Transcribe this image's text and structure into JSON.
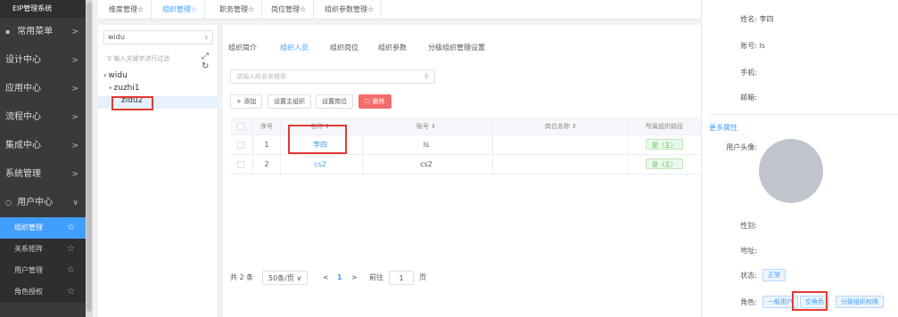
{
  "sidebar": {
    "brand": "EIP管理系统",
    "menus": [
      {
        "label": "常用菜单",
        "chevron": ">"
      },
      {
        "label": "设计中心",
        "chevron": ">"
      },
      {
        "label": "应用中心",
        "chevron": ">"
      },
      {
        "label": "流程中心",
        "chevron": ">"
      },
      {
        "label": "集成中心",
        "chevron": ">"
      },
      {
        "label": "系统管理",
        "chevron": ">"
      },
      {
        "label": "用户中心",
        "chevron": "∨"
      }
    ],
    "sub_items": [
      {
        "label": "组织管理",
        "active": true
      },
      {
        "label": "关系矩阵"
      },
      {
        "label": "用户管理"
      },
      {
        "label": "角色授权"
      }
    ]
  },
  "top_tabs": [
    "维度管理☆",
    "组织管理☆",
    "职务管理☆",
    "岗位管理☆",
    "组织参数管理☆"
  ],
  "tree": {
    "select_value": "widu",
    "search_placeholder": "输入关键字进行过滤",
    "nodes": [
      "widu",
      "zuzhi1",
      "zidu2"
    ]
  },
  "main": {
    "sub_tabs": [
      "组织简介",
      "组织人员",
      "组织岗位",
      "组织参数",
      "分级组织管理设置"
    ],
    "search_placeholder": "请输入姓名来搜索",
    "buttons": {
      "add": "+ 添加",
      "set_main": "设置主组织",
      "set_post": "设置岗位",
      "delete": "☐ 删除"
    },
    "columns": [
      "序号",
      "名称 ⇕",
      "账号 ⇕",
      "岗位名称 ⇕",
      "所属组织路径"
    ],
    "rows": [
      {
        "index": "1",
        "name": "李四",
        "account": "ls",
        "post": "",
        "path_tag": "是（主）"
      },
      {
        "index": "2",
        "name": "cs2",
        "account": "cs2",
        "post": "",
        "path_tag": "是（主）"
      }
    ],
    "pager": {
      "total": "共 2 条",
      "page_size": "50条/页 ∨",
      "prev": "<",
      "current": "1",
      "next": ">",
      "goto": "前往",
      "goto_value": "1",
      "page_unit": "页"
    }
  },
  "detail": {
    "name_label": "姓名:",
    "name_value": "李四",
    "account_label": "账号:",
    "account_value": "ls",
    "phone_label": "手机:",
    "phone_value": "",
    "email_label": "邮箱:",
    "email_value": "",
    "more_attr": "更多属性",
    "avatar_label": "用户头像:",
    "gender_label": "性别:",
    "address_label": "地址:",
    "status_label": "状态:",
    "status_value": "正常",
    "roles_label": "角色:",
    "roles": [
      "一般用户",
      "空角色",
      "分级组织权限"
    ]
  }
}
